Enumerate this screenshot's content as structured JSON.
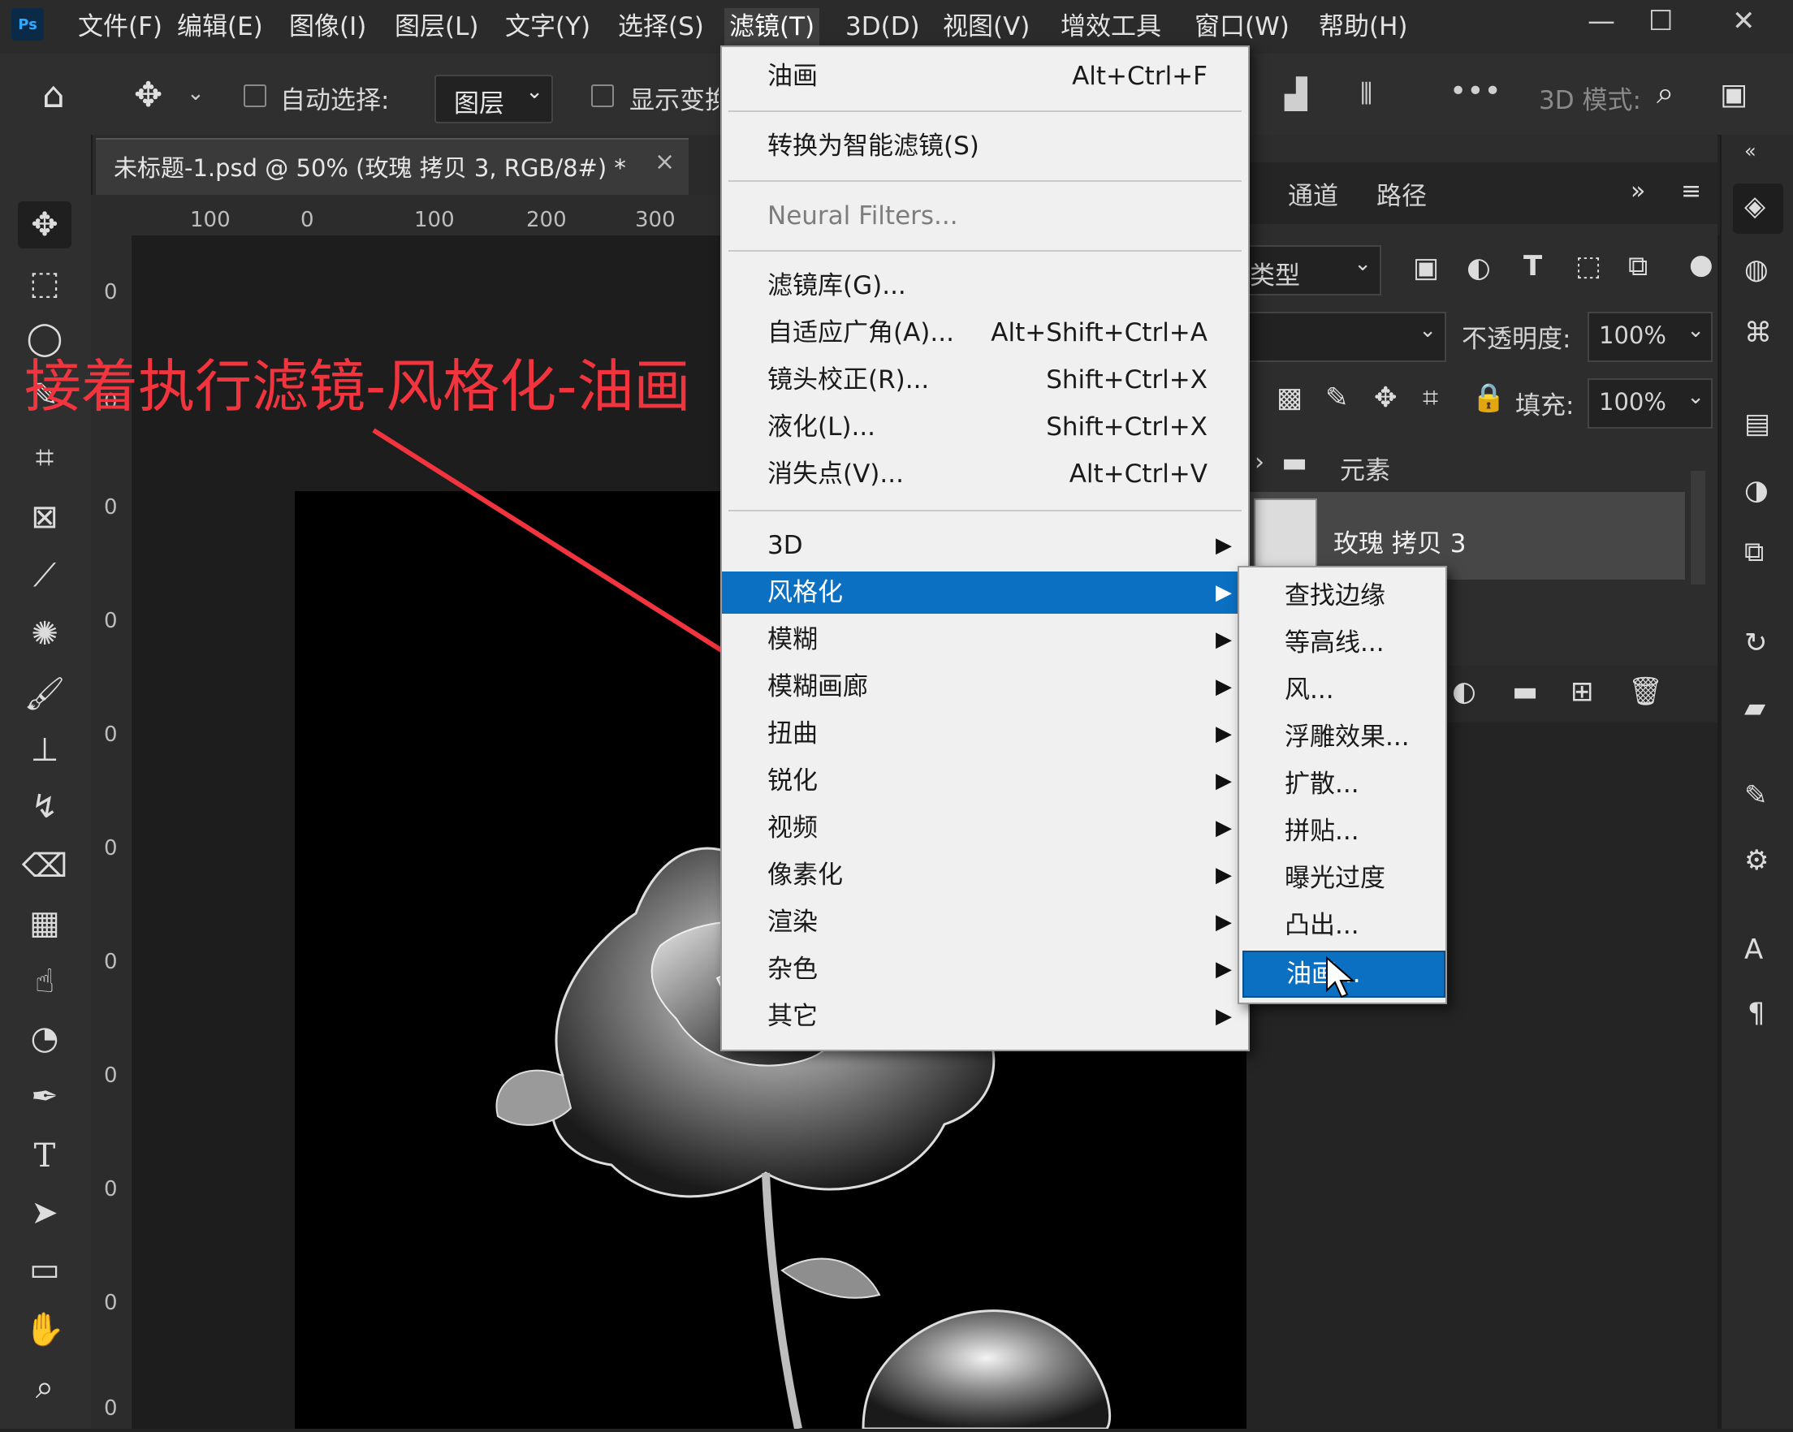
{
  "app": {
    "logo": "Ps",
    "menus": [
      "文件(F)",
      "编辑(E)",
      "图像(I)",
      "图层(L)",
      "文字(Y)",
      "选择(S)",
      "滤镜(T)",
      "3D(D)",
      "视图(V)",
      "增效工具",
      "窗口(W)",
      "帮助(H)"
    ],
    "active_menu": "滤镜(T)"
  },
  "options_bar": {
    "auto_select_label": "自动选择:",
    "auto_select_value": "图层",
    "show_transform_label": "显示变换控件",
    "mode_3d_label": "3D 模式:"
  },
  "document_tab": {
    "title": "未标题-1.psd @ 50% (玫瑰 拷贝 3, RGB/8#) *",
    "close": "×"
  },
  "ruler": {
    "h_ticks": [
      "100",
      "0",
      "100",
      "200",
      "300"
    ],
    "v_ticks": [
      "0",
      "0",
      "0",
      "0",
      "0",
      "0",
      "0",
      "0",
      "0",
      "0",
      "0"
    ]
  },
  "filter_menu": {
    "top_items": [
      {
        "label": "油画",
        "shortcut": "Alt+Ctrl+F"
      },
      {
        "label": "转换为智能滤镜(S)",
        "shortcut": ""
      },
      {
        "label": "Neural Filters...",
        "shortcut": ""
      }
    ],
    "mid_items": [
      {
        "label": "滤镜库(G)...",
        "shortcut": ""
      },
      {
        "label": "自适应广角(A)...",
        "shortcut": "Alt+Shift+Ctrl+A"
      },
      {
        "label": "镜头校正(R)...",
        "shortcut": "Shift+Ctrl+X"
      },
      {
        "label": "液化(L)...",
        "shortcut": "Shift+Ctrl+X"
      },
      {
        "label": "消失点(V)...",
        "shortcut": "Alt+Ctrl+V"
      }
    ],
    "sub_items": [
      {
        "label": "3D"
      },
      {
        "label": "风格化"
      },
      {
        "label": "模糊"
      },
      {
        "label": "模糊画廊"
      },
      {
        "label": "扭曲"
      },
      {
        "label": "锐化"
      },
      {
        "label": "视频"
      },
      {
        "label": "像素化"
      },
      {
        "label": "渲染"
      },
      {
        "label": "杂色"
      },
      {
        "label": "其它"
      }
    ],
    "highlighted": "风格化"
  },
  "stylize_submenu": {
    "items": [
      "查找边缘",
      "等高线...",
      "风...",
      "浮雕效果...",
      "扩散...",
      "拼贴...",
      "曝光过度",
      "凸出...",
      "油画..."
    ],
    "highlighted": "油画..."
  },
  "layers_panel": {
    "tabs": [
      "通道",
      "路径"
    ],
    "filter_kind": "类型",
    "opacity_label": "不透明度:",
    "opacity_value": "100%",
    "fill_label": "填充:",
    "fill_value": "100%",
    "group_name": "元素",
    "layer_name": "玫瑰 拷贝 3"
  },
  "annotation": {
    "text": "接着执行滤镜-风格化-油画",
    "color": "#f2343e"
  },
  "colors": {
    "highlight": "#0b6fc2",
    "menu_bg": "#f0f0f0",
    "ui_dark": "#2b2b2b"
  }
}
